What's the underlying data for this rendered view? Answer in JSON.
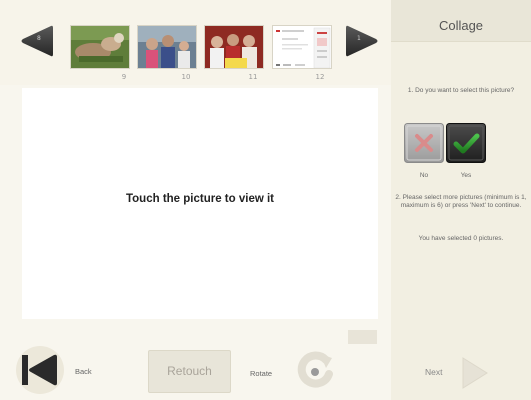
{
  "filmstrip": {
    "prev_arrow_num": "8",
    "next_arrow_num": "1",
    "thumbnails": [
      {
        "number": "9"
      },
      {
        "number": "10"
      },
      {
        "number": "11"
      },
      {
        "number": "12"
      }
    ]
  },
  "viewer": {
    "message": "Touch the picture to view it"
  },
  "panel": {
    "title": "Collage",
    "question1": "1. Do you want to select this picture?",
    "no_label": "No",
    "yes_label": "Yes",
    "question2": "2. Please select more pictures (minimum is 1, maximum is 6) or press 'Next' to continue.",
    "selected_count": "You have selected 0 pictures."
  },
  "toolbar": {
    "back_label": "Back",
    "retouch_label": "Retouch",
    "rotate_label": "Rotate",
    "next_label": "Next"
  },
  "colors": {
    "accent_green": "#2f8a2f",
    "panel_bg": "#f2efe2",
    "arrow_dark": "#3b3b3b"
  }
}
